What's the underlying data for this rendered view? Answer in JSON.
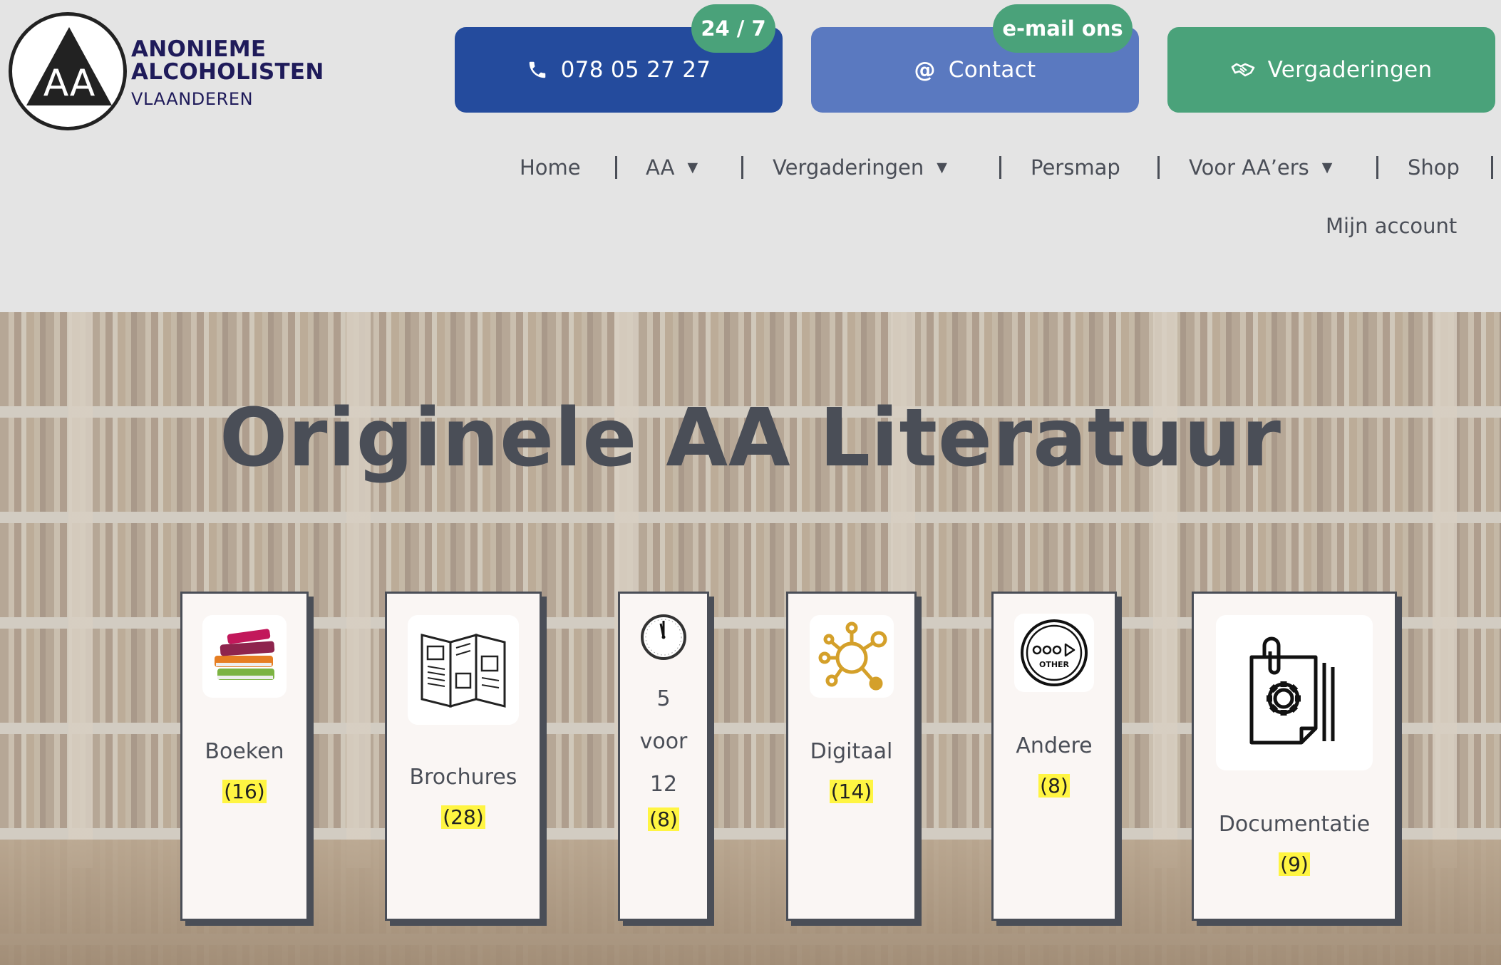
{
  "logo": {
    "line1": "ANONIEME",
    "line2": "ALCOHOLISTEN",
    "line3": "VLAANDEREN"
  },
  "cta": {
    "phone": {
      "label": "078 05 27 27",
      "badge": "24 / 7",
      "icon": "phone-icon"
    },
    "contact": {
      "label": "Contact",
      "badge": "e-mail ons",
      "icon": "at-icon"
    },
    "meetings": {
      "label": "Vergaderingen",
      "icon": "handshake-icon"
    }
  },
  "nav": {
    "items": [
      {
        "label": "Home",
        "dropdown": false
      },
      {
        "label": "AA",
        "dropdown": true
      },
      {
        "label": "Vergaderingen",
        "dropdown": true
      },
      {
        "label": "Persmap",
        "dropdown": false
      },
      {
        "label": "Voor AA’ers",
        "dropdown": true
      },
      {
        "label": "Shop",
        "dropdown": false
      }
    ],
    "account": "Mijn account"
  },
  "hero": {
    "title": "Originele AA Literatuur"
  },
  "categories": [
    {
      "label": "Boeken",
      "count": "(16)",
      "icon": "books-icon"
    },
    {
      "label": "Brochures",
      "count": "(28)",
      "icon": "brochure-icon"
    },
    {
      "label_lines": [
        "5",
        "voor",
        "12"
      ],
      "count": "(8)",
      "icon": "clock-icon"
    },
    {
      "label": "Digitaal",
      "count": "(14)",
      "icon": "network-icon"
    },
    {
      "label": "Andere",
      "count": "(8)",
      "icon": "other-icon",
      "icon_text": "OTHER"
    },
    {
      "label": "Documentatie",
      "count": "(9)",
      "icon": "document-gear-icon"
    }
  ],
  "colors": {
    "phone_button": "#244b9d",
    "contact_button": "#5a79c0",
    "meetings_button": "#4aa27a",
    "badge": "#4aa27a",
    "count_highlight": "#fff542",
    "text": "#4a4e57",
    "logo_text": "#1f1b5a"
  }
}
